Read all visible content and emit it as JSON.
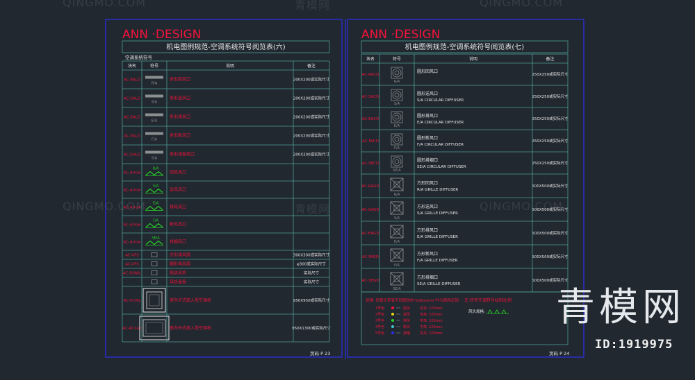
{
  "colors": {
    "background": "#212830",
    "frame": "#2d2ff0",
    "grid": "#4e9e94",
    "red": "#f5133a",
    "white": "#e8e8e8",
    "symbol": "#8a8f90",
    "yellow": "#e6d619",
    "green": "#28d028",
    "cyan": "#3cc9d0"
  },
  "sheets": [
    {
      "brand": "ANN ·DESIGN",
      "title": "机电图例规范-空调系统符号阅览表(六)",
      "section": "空调系统符号",
      "headers": [
        "块名",
        "符号",
        "说明",
        "备注"
      ],
      "rows": [
        {
          "code": "AC-RALD",
          "sym": "bar",
          "sub": "R/A",
          "desc": "条形回风口",
          "note": "200X200或实际尺寸"
        },
        {
          "code": "AC-SALD",
          "sym": "bar",
          "sub": "S/A",
          "desc": "条形送风口",
          "note": "200X200或实际尺寸"
        },
        {
          "code": "AC-EALD",
          "sym": "bar",
          "sub": "E/A",
          "desc": "条形排风口",
          "note": "200X200或实际尺寸"
        },
        {
          "code": "AC-FALD",
          "sym": "bar",
          "sub": "F/A",
          "desc": "条形新风口",
          "note": "200X200或实际尺寸"
        },
        {
          "code": "AC-SHLD",
          "sym": "bar",
          "sub": "S/A",
          "desc": "条形排烟风口",
          "note": "200X200或实际尺寸"
        },
        {
          "code": "AC-Arrow",
          "sym": "arrow",
          "sub": "R/A",
          "desc": "回风风口",
          "note": ""
        },
        {
          "code": "AC-Arrow",
          "sym": "arrow",
          "sub": "S/A",
          "desc": "送风风口",
          "note": ""
        },
        {
          "code": "AC-Arrow",
          "sym": "arrow",
          "sub": "E/A",
          "desc": "排风风口",
          "note": ""
        },
        {
          "code": "AC-Arrow",
          "sym": "arrow",
          "sub": "F/A",
          "desc": "新风风口",
          "note": ""
        },
        {
          "code": "AC-Arrow",
          "sym": "arrow",
          "sub": "SE/A",
          "desc": "排烟风口",
          "note": ""
        },
        {
          "code": "AC-VFS",
          "sym": "small",
          "sub": "",
          "desc": "方形排风扇",
          "note": "300X300或实际尺寸"
        },
        {
          "code": "AC-VFS",
          "sym": "small",
          "sub": "",
          "desc": "圆形排风扇",
          "note": "φ300或实际尺寸"
        },
        {
          "code": "AC-DOWL",
          "sym": "small",
          "sub": "",
          "desc": "侧送风机",
          "note": "实际尺寸"
        },
        {
          "code": "",
          "sym": "small",
          "sub": "",
          "desc": "风机盘管",
          "note": "实际尺寸"
        },
        {
          "code": "AC-FCWL",
          "sym": "cassette",
          "sub": "",
          "desc": "室内卡式嵌入型空调机",
          "note": "950X950或实际尺寸"
        },
        {
          "code": "AC-RC140",
          "sym": "cassette2",
          "sub": "",
          "desc": "室内卡式嵌入型空调机",
          "note": "950X1300或实际尺寸"
        }
      ],
      "page": "页码  P 23"
    },
    {
      "brand": "ANN ·DESIGN",
      "title": "机电图例规范-空调系统符号阅览表(七)",
      "headers": [
        "块名",
        "符号",
        "说明",
        "备注"
      ],
      "rows": [
        {
          "code": "AC-RACD",
          "sym": "round",
          "sub": "R/A",
          "desc1": "圆形回风口",
          "desc2": "",
          "note": "250X250或实际尺寸"
        },
        {
          "code": "AC-SACD",
          "sym": "round",
          "sub": "S/A",
          "desc1": "圆形送风口",
          "desc2": "S/A CIRCULAR DIFFUSER",
          "note": "250X250或实际尺寸"
        },
        {
          "code": "AC-EACD",
          "sym": "round",
          "sub": "E/A",
          "desc1": "圆形排风口",
          "desc2": "E/A CIRCULAR DIFFUSER",
          "note": "250X250或实际尺寸"
        },
        {
          "code": "AC-FACD",
          "sym": "round",
          "sub": "F/A",
          "desc1": "圆形新风口",
          "desc2": "F/A CIRCULAR DIFFUSER",
          "note": "250X250或实际尺寸"
        },
        {
          "code": "AC-SECD",
          "sym": "round",
          "sub": "SE/A",
          "desc1": "圆形排烟口",
          "desc2": "SE/A CIRCULAR DIFFUSER",
          "note": "250X250或实际尺寸"
        },
        {
          "code": "AC-RAGD",
          "sym": "square",
          "sub": "R/A",
          "desc1": "方形回风口",
          "desc2": "R/A GRILLE DIFFUSER",
          "note": "500X500或实际尺寸"
        },
        {
          "code": "AC-SAGD",
          "sym": "square",
          "sub": "S/A",
          "desc1": "方形送风口",
          "desc2": "S/A GRILLE DIFFUSER",
          "note": "500X500或实际尺寸"
        },
        {
          "code": "AC-EAGD",
          "sym": "square",
          "sub": "E/A",
          "desc1": "方形排风口",
          "desc2": "E/A GRILLE DIFFUSER",
          "note": "500X500或实际尺寸"
        },
        {
          "code": "AC-FAGD",
          "sym": "square",
          "sub": "F/A",
          "desc1": "方形新风口",
          "desc2": "F/A GRILLE DIFFUSER",
          "note": "500X500或实际尺寸"
        },
        {
          "code": "AC-SEGD",
          "sym": "square",
          "sub": "SE/A",
          "desc1": "方形排烟口",
          "desc2": "SE/A GRILLE DIFFUSER",
          "note": "500X500或实际尺寸"
        }
      ],
      "legend_title": "说明: 风管头带有不同颜色的\"Defpoints\"作为颜色区别",
      "legend": [
        {
          "label": "1号色",
          "color": "#f5133a",
          "name": "回风",
          "note": "字高: 100mm"
        },
        {
          "label": "2号色",
          "color": "#e6d619",
          "name": "送风",
          "note": "字高: 100mm"
        },
        {
          "label": "3号色",
          "color": "#28d028",
          "name": "排风",
          "note": "字高: 100mm"
        },
        {
          "label": "4号色",
          "color": "#3cc9d0",
          "name": "新风",
          "note": "字高: 100mm"
        },
        {
          "label": "5号色",
          "color": "#2d2ff0",
          "name": "排烟",
          "note": "字高: 100mm"
        }
      ],
      "note_right": "注:所有空调符号绘制比例",
      "note_right2": "风头规格:",
      "page": "页码  P 24"
    }
  ],
  "watermarks": {
    "site": "QINGMO.COM",
    "cn": "青模网",
    "big": "青模网",
    "id": "ID:1919975"
  }
}
